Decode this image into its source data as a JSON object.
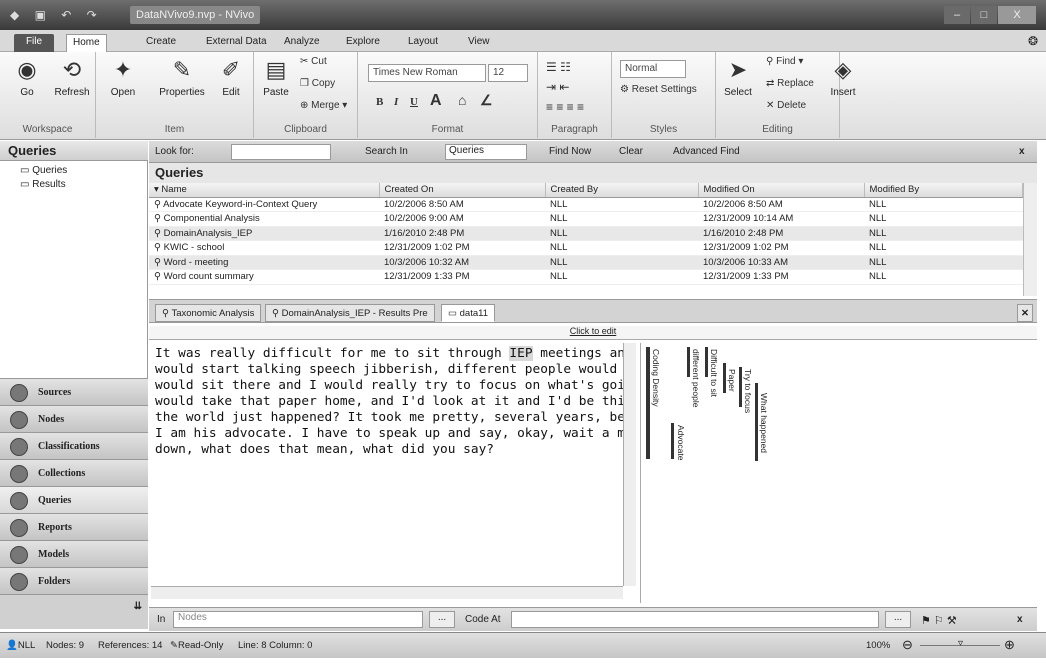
{
  "window": {
    "title": "DataNVivo9.nvp - NVivo",
    "controls": [
      "–",
      "□",
      "X"
    ]
  },
  "ribbon_tabs": [
    "File",
    "Home",
    "Create",
    "External Data",
    "Analyze",
    "Explore",
    "Layout",
    "View"
  ],
  "ribbon": {
    "workspace": {
      "label": "Workspace",
      "go": "Go",
      "refresh": "Refresh"
    },
    "item": {
      "label": "Item",
      "open": "Open",
      "properties": "Properties",
      "edit": "Edit"
    },
    "clipboard": {
      "label": "Clipboard",
      "paste": "Paste",
      "cut": "Cut",
      "copy": "Copy",
      "merge": "Merge"
    },
    "format": {
      "label": "Format",
      "font": "Times New Roman",
      "size": "12",
      "bold": "B",
      "italic": "I",
      "underline": "U"
    },
    "paragraph": {
      "label": "Paragraph"
    },
    "styles": {
      "label": "Styles",
      "style": "Normal",
      "reset": "Reset Settings"
    },
    "editing": {
      "label": "Editing",
      "select": "Select",
      "find": "Find",
      "replace": "Replace",
      "delete": "Delete",
      "insert": "Insert"
    }
  },
  "left_panel": {
    "header": "Queries",
    "tree": [
      "Queries",
      "Results"
    ],
    "nav": [
      "Sources",
      "Nodes",
      "Classifications",
      "Collections",
      "Queries",
      "Reports",
      "Models",
      "Folders"
    ]
  },
  "find_bar": {
    "look_for": "Look for:",
    "search_in": "Search In",
    "search_in_value": "Queries",
    "find_now": "Find Now",
    "clear": "Clear",
    "advanced_find": "Advanced Find",
    "close": "x"
  },
  "queries_list": {
    "title": "Queries",
    "columns": [
      "Name",
      "Created On",
      "Created By",
      "Modified On",
      "Modified By"
    ],
    "rows": [
      [
        "Advocate Keyword-in-Context Query",
        "10/2/2006 8:50 AM",
        "NLL",
        "10/2/2006 8:50 AM",
        "NLL"
      ],
      [
        "Componential Analysis",
        "10/2/2006 9:00 AM",
        "NLL",
        "12/31/2009 10:14 AM",
        "NLL"
      ],
      [
        "DomainAnalysis_IEP",
        "1/16/2010 2:48 PM",
        "NLL",
        "1/16/2010 2:48 PM",
        "NLL"
      ],
      [
        "KWIC - school",
        "12/31/2009 1:02 PM",
        "NLL",
        "12/31/2009 1:02 PM",
        "NLL"
      ],
      [
        "Word - meeting",
        "10/3/2006 10:32 AM",
        "NLL",
        "10/3/2006 10:33 AM",
        "NLL"
      ],
      [
        "Word count summary",
        "12/31/2009 1:33 PM",
        "NLL",
        "12/31/2009 1:33 PM",
        "NLL"
      ]
    ]
  },
  "doc_tabs": [
    "Taxonomic Analysis",
    "DomainAnalysis_IEP - Results Pre",
    "data11"
  ],
  "click_to_edit": "Click to edit",
  "document": {
    "line1_pre": "It was really difficult for me to sit through ",
    "line1_hl": "IEP",
    "line1_post": " meetings and differen",
    "lines": [
      "would start talking speech jibberish, different people would say thing",
      "would sit there and I would really try to focus on what's going on. B",
      "would take that paper home, and I'd look at it and I'd be thinking, w",
      "the world just happened? It took me pretty, several years, before I",
      "I am his advocate. I have to speak up and say, okay, wait a minute,",
      "down, what does that mean, what did you say?"
    ]
  },
  "coding_stripes": [
    "Coding Density",
    "different people",
    "Difficult to sit",
    "Paper",
    "Try to focus",
    "What happened",
    "Advocate"
  ],
  "code_bar": {
    "in": "In",
    "in_value": "Nodes",
    "code_at": "Code At",
    "close": "x"
  },
  "status_bar": {
    "user": "NLL",
    "nodes": "Nodes: 9",
    "references": "References: 14",
    "readonly": "Read-Only",
    "position": "Line: 8 Column: 0",
    "zoom": "100%"
  }
}
